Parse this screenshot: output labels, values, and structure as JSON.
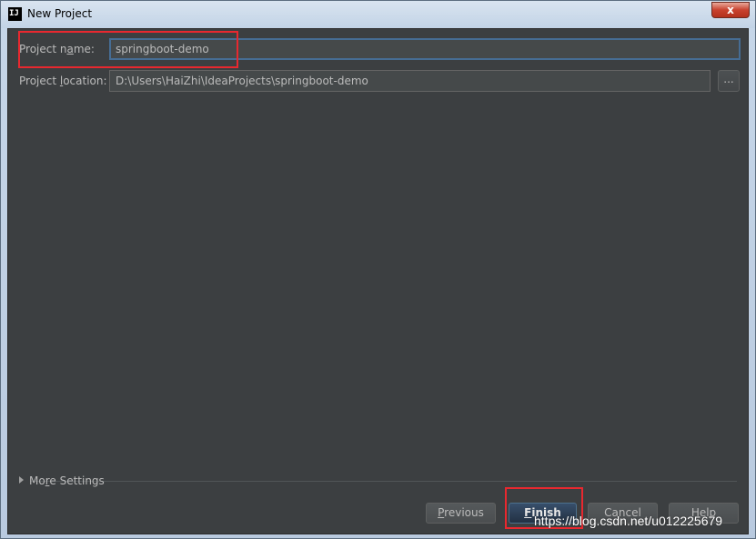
{
  "window": {
    "title": "New Project",
    "app_icon": "IJ",
    "close_label": "x"
  },
  "form": {
    "project_name": {
      "label_prefix": "Project n",
      "label_underline": "a",
      "label_suffix": "me:",
      "value": "springboot-demo"
    },
    "project_location": {
      "label_prefix": "Project ",
      "label_underline": "l",
      "label_suffix": "ocation:",
      "value": "D:\\Users\\HaiZhi\\IdeaProjects\\springboot-demo",
      "browse_label": "..."
    }
  },
  "more_settings": {
    "label_prefix": "Mo",
    "label_underline": "r",
    "label_suffix": "e Settings"
  },
  "buttons": {
    "previous": {
      "underline": "P",
      "rest": "revious"
    },
    "finish": {
      "underline": "F",
      "rest": "inish"
    },
    "cancel": "Cancel",
    "help": "Help"
  },
  "watermark": "https://blog.csdn.net/u012225679",
  "colors": {
    "dialog_bg": "#3c3f41",
    "input_bg": "#45494a",
    "focus_border": "#466d94",
    "annotation_red": "#e8282f",
    "text": "#bbbbbb"
  }
}
